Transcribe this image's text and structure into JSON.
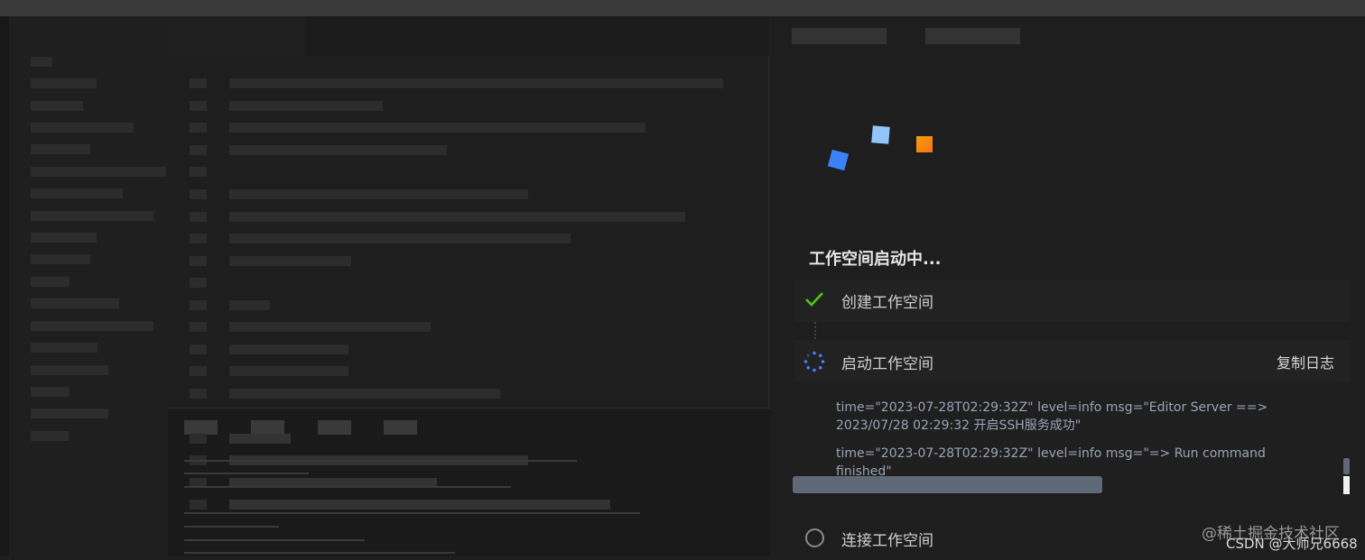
{
  "workspace": {
    "title": "工作空间启动中...",
    "steps": [
      {
        "label": "创建工作空间",
        "status": "done"
      },
      {
        "label": "启动工作空间",
        "status": "loading",
        "action": "复制日志"
      },
      {
        "label": "连接工作空间",
        "status": "pending"
      }
    ],
    "logs": [
      "time=\"2023-07-28T02:29:32Z\" level=info msg=\"Editor Server ==> 2023/07/28 02:29:32 开启SSH服务成功\"",
      "time=\"2023-07-28T02:29:32Z\" level=info msg=\"=> Run command finished\""
    ]
  },
  "watermark": {
    "line1": "@稀土掘金技术社区",
    "line2": "CSDN @大师兄6668"
  },
  "colors": {
    "check": "#52c41a",
    "spinner": "#3b82f6",
    "logo_blue": "#3b82f6",
    "logo_light": "#93c5fd",
    "logo_orange": "#f59e0b"
  }
}
